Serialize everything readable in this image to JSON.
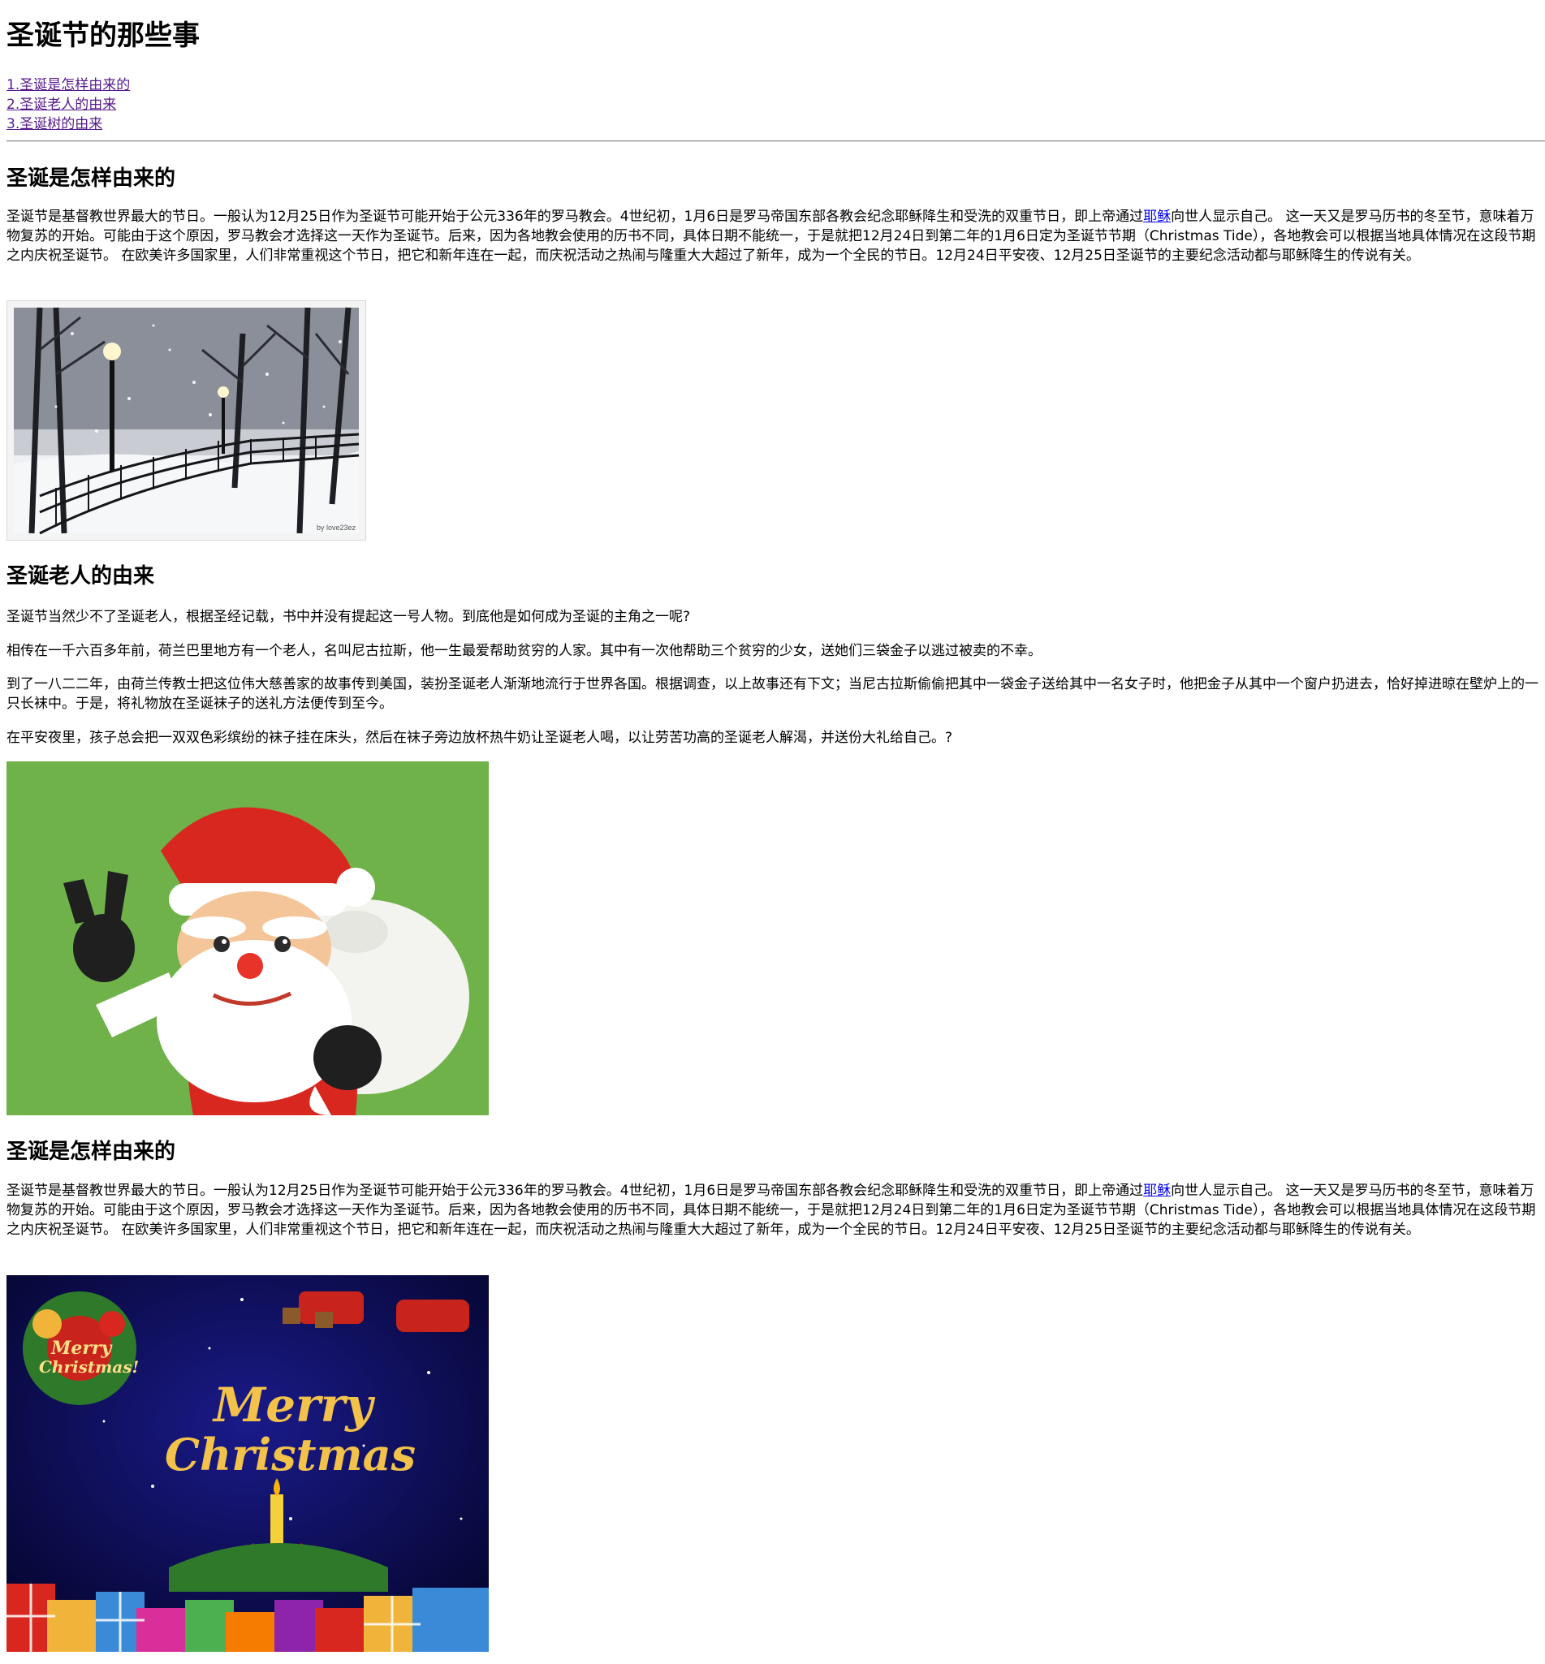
{
  "title": "圣诞节的那些事",
  "toc": [
    "1.圣诞是怎样由来的",
    "2.圣诞老人的由来",
    "3.圣诞树的由来"
  ],
  "section1": {
    "heading": "圣诞是怎样由来的",
    "p_before": "圣诞节是基督教世界最大的节日。一般认为12月25日作为圣诞节可能开始于公元336年的罗马教会。4世纪初，1月6日是罗马帝国东部各教会纪念耶稣降生和受洗的双重节日，即上帝通过",
    "link": "耶稣",
    "p_after": "向世人显示自己。 这一天又是罗马历书的冬至节，意味着万物复苏的开始。可能由于这个原因，罗马教会才选择这一天作为圣诞节。后来，因为各地教会使用的历书不同，具体日期不能统一，于是就把12月24日到第二年的1月6日定为圣诞节节期（Christmas Tide），各地教会可以根据当地具体情况在这段节期之内庆祝圣诞节。 在欧美许多国家里，人们非常重视这个节日，把它和新年连在一起，而庆祝活动之热闹与隆重大大超过了新年，成为一个全民的节日。12月24日平安夜、12月25日圣诞节的主要纪念活动都与耶稣降生的传说有关。",
    "image_watermark": "by love23ez"
  },
  "section2": {
    "heading": "圣诞老人的由来",
    "paragraphs": [
      "圣诞节当然少不了圣诞老人，根据圣经记载，书中并没有提起这一号人物。到底他是如何成为圣诞的主角之一呢?",
      "相传在一千六百多年前，荷兰巴里地方有一个老人，名叫尼古拉斯，他一生最爱帮助贫穷的人家。其中有一次他帮助三个贫穷的少女，送她们三袋金子以逃过被卖的不幸。",
      "到了一八二二年，由荷兰传教士把这位伟大慈善家的故事传到美国，装扮圣诞老人渐渐地流行于世界各国。根据调查，以上故事还有下文；当尼古拉斯偷偷把其中一袋金子送给其中一名女子时，他把金子从其中一个窗户扔进去，恰好掉进晾在壁炉上的一只长袜中。于是，将礼物放在圣诞袜子的送礼方法便传到至今。",
      "在平安夜里，孩子总会把一双双色彩缤纷的袜子挂在床头，然后在袜子旁边放杯热牛奶让圣诞老人喝，以让劳苦功高的圣诞老人解渴，并送份大礼给自己。?"
    ]
  },
  "section3": {
    "heading": "圣诞是怎样由来的",
    "p_before": "圣诞节是基督教世界最大的节日。一般认为12月25日作为圣诞节可能开始于公元336年的罗马教会。4世纪初，1月6日是罗马帝国东部各教会纪念耶稣降生和受洗的双重节日，即上帝通过",
    "link": "耶稣",
    "p_after": "向世人显示自己。 这一天又是罗马历书的冬至节，意味着万物复苏的开始。可能由于这个原因，罗马教会才选择这一天作为圣诞节。后来，因为各地教会使用的历书不同，具体日期不能统一，于是就把12月24日到第二年的1月6日定为圣诞节节期（Christmas Tide），各地教会可以根据当地具体情况在这段节期之内庆祝圣诞节。 在欧美许多国家里，人们非常重视这个节日，把它和新年连在一起，而庆祝活动之热闹与隆重大大超过了新年，成为一个全民的节日。12月24日平安夜、12月25日圣诞节的主要纪念活动都与耶稣降生的传说有关。",
    "poster_text_1": "Merry",
    "poster_text_2": "Christmas",
    "poster_small_1": "Merry",
    "poster_small_2": "Christmas!"
  },
  "colors": {
    "visited_link": "#551a8b",
    "link": "#0000ee",
    "santa_bg": "#6fb24a",
    "poster_bg": "#0a0a5a"
  }
}
